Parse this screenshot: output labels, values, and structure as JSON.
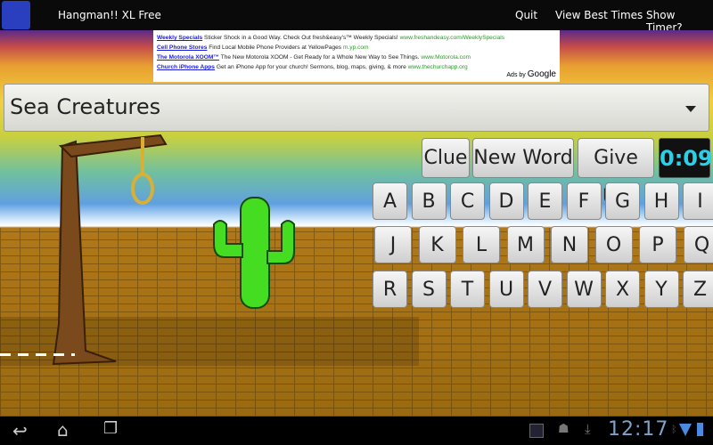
{
  "titlebar": {
    "app_title": "Hangman!! XL Free",
    "menu": [
      "Quit",
      "View Best Times",
      "Show Timer?"
    ]
  },
  "ads": {
    "items": [
      {
        "title": "Weekly Specials",
        "text": "Sticker Shock in a Good Way. Check Out fresh&easy's™ Weekly Specials!",
        "url": "www.freshandeasy.com/WeeklySpecials"
      },
      {
        "title": "Cell Phone Stores",
        "text": "Find Local Mobile Phone Providers at YellowPages",
        "url": "m.yp.com"
      },
      {
        "title": "The Motorola XOOM™",
        "text": "The New Motorola XOOM - Get Ready for a Whole New Way to See Things.",
        "url": "www.Motorola.com"
      },
      {
        "title": "Church iPhone Apps",
        "text": "Get an iPhone App for your church! Sermons, blog, maps, giving, & more",
        "url": "www.thechurchapp.org"
      }
    ],
    "ads_by": "Ads by",
    "google": "Google"
  },
  "category": {
    "selected": "Sea Creatures"
  },
  "controls": {
    "clue": "Clue",
    "new_word": "New Word",
    "give_up": "Give Up",
    "timer": "0:09"
  },
  "keyboard": {
    "rows": [
      [
        "A",
        "B",
        "C",
        "D",
        "E",
        "F",
        "G",
        "H",
        "I"
      ],
      [
        "J",
        "K",
        "L",
        "M",
        "N",
        "O",
        "P",
        "Q"
      ],
      [
        "R",
        "S",
        "T",
        "U",
        "V",
        "W",
        "X",
        "Y",
        "Z"
      ]
    ]
  },
  "statusbar": {
    "clock": "12:17"
  }
}
